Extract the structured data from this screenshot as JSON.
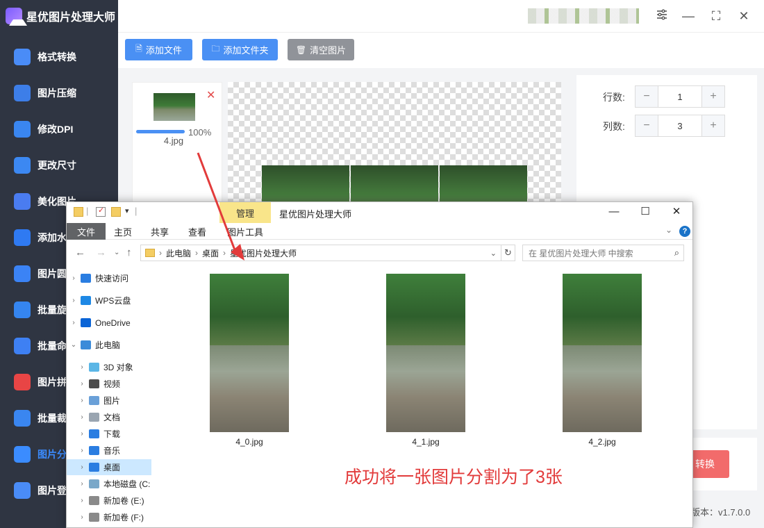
{
  "app": {
    "title": "星优图片处理大师",
    "sidebar": [
      {
        "label": "格式转换",
        "color": "#4a8cf7"
      },
      {
        "label": "图片压缩",
        "color": "#3d7ee8"
      },
      {
        "label": "修改DPI",
        "color": "#3a86f0"
      },
      {
        "label": "更改尺寸",
        "color": "#3c88f2"
      },
      {
        "label": "美化图片",
        "color": "#4a7cf0"
      },
      {
        "label": "添加水",
        "color": "#2f7af2"
      },
      {
        "label": "图片圆",
        "color": "#3b83f5"
      },
      {
        "label": "批量旋",
        "color": "#3585ef"
      },
      {
        "label": "批量命",
        "color": "#3e80f3"
      },
      {
        "label": "图片拼",
        "color": "#e84545"
      },
      {
        "label": "批量裁",
        "color": "#3a86f0"
      },
      {
        "label": "图片分",
        "color": "#3b8cff",
        "active": true
      },
      {
        "label": "图片登",
        "color": "#4a8cf7"
      }
    ],
    "toolbar": {
      "add_file": "添加文件",
      "add_folder": "添加文件夹",
      "clear": "清空图片"
    },
    "file": {
      "name": "4.jpg",
      "progress_pct": "100%",
      "progress": 1.0
    },
    "settings": {
      "rows_label": "行数:",
      "rows_value": "1",
      "cols_label": "列数:",
      "cols_value": "3"
    },
    "convert_label": "转换",
    "version": "版本：v1.7.0.0",
    "window_controls": {
      "settings_icon": "sliders-icon",
      "minimize": "—",
      "maximize": "⛶",
      "close": "✕"
    }
  },
  "explorer": {
    "manage_tab": "管理",
    "title": "星优图片处理大师",
    "ribbon": {
      "file": "文件",
      "home": "主页",
      "share": "共享",
      "view": "查看",
      "picture_tools": "图片工具"
    },
    "breadcrumb": [
      "此电脑",
      "桌面",
      "星优图片处理大师"
    ],
    "search_placeholder": "在 星优图片处理大师 中搜索",
    "tree": [
      {
        "label": "快速访问",
        "icon": "star-icon",
        "color": "#2a7de1",
        "chevron": "›",
        "indent": 0
      },
      {
        "label": "WPS云盘",
        "icon": "cloud-icon",
        "color": "#1e88e5",
        "chevron": "›",
        "indent": 0
      },
      {
        "label": "OneDrive",
        "icon": "onedrive-icon",
        "color": "#0a64d6",
        "chevron": "›",
        "indent": 0
      },
      {
        "label": "此电脑",
        "icon": "computer-icon",
        "color": "#3b8bd9",
        "chevron": "⌄",
        "indent": 0
      },
      {
        "label": "3D 对象",
        "icon": "cube-icon",
        "color": "#5bb6e6",
        "chevron": "›",
        "indent": 1
      },
      {
        "label": "视频",
        "icon": "video-icon",
        "color": "#4c4c4c",
        "chevron": "›",
        "indent": 1
      },
      {
        "label": "图片",
        "icon": "pictures-icon",
        "color": "#6aa0d8",
        "chevron": "›",
        "indent": 1
      },
      {
        "label": "文档",
        "icon": "document-icon",
        "color": "#9aa5b1",
        "chevron": "›",
        "indent": 1
      },
      {
        "label": "下载",
        "icon": "download-icon",
        "color": "#2a7de1",
        "chevron": "›",
        "indent": 1
      },
      {
        "label": "音乐",
        "icon": "music-icon",
        "color": "#2a7de1",
        "chevron": "›",
        "indent": 1
      },
      {
        "label": "桌面",
        "icon": "desktop-icon",
        "color": "#2a7de1",
        "chevron": "›",
        "indent": 1,
        "selected": true
      },
      {
        "label": "本地磁盘 (C:",
        "icon": "drive-icon",
        "color": "#7aa8c9",
        "chevron": "›",
        "indent": 1
      },
      {
        "label": "新加卷 (E:)",
        "icon": "drive-icon",
        "color": "#8a8a8a",
        "chevron": "›",
        "indent": 1
      },
      {
        "label": "新加卷 (F:)",
        "icon": "drive-icon",
        "color": "#8a8a8a",
        "chevron": "›",
        "indent": 1
      }
    ],
    "files": [
      {
        "name": "4_0.jpg"
      },
      {
        "name": "4_1.jpg"
      },
      {
        "name": "4_2.jpg"
      }
    ]
  },
  "annotation": {
    "text": "成功将一张图片分割为了3张",
    "color": "#e23b3b"
  }
}
